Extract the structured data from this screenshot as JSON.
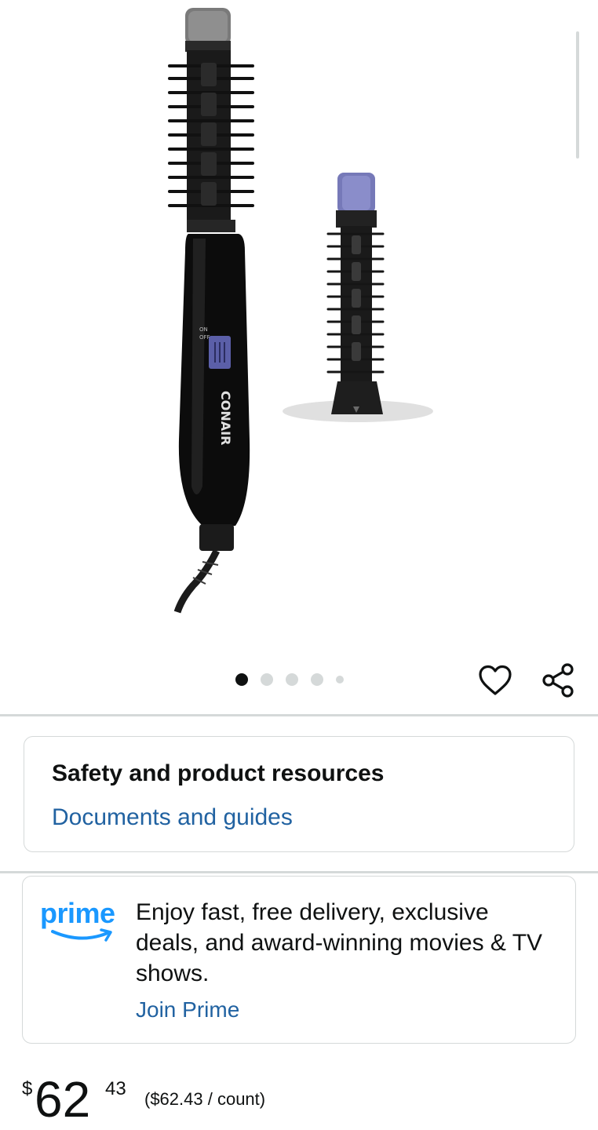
{
  "gallery": {
    "image_alt": "Conair hot air brush with interchangeable brush attachment",
    "brand_text": "CONAIR",
    "switch_on": "ON",
    "switch_off": "OFF",
    "dots_count": 5,
    "active_dot": 1
  },
  "actions": {
    "wishlist_icon": "heart-icon",
    "share_icon": "share-icon"
  },
  "safety": {
    "title": "Safety and product resources",
    "link": "Documents and guides"
  },
  "prime": {
    "logo_text": "prime",
    "text": "Enjoy fast, free delivery, exclusive deals, and award-winning movies & TV shows.",
    "link": "Join Prime"
  },
  "price": {
    "symbol": "$",
    "whole": "62",
    "fraction": "43",
    "unit_price": "($62.43 / count)"
  },
  "colors": {
    "link": "#2162a1",
    "prime_blue": "#1a98ff",
    "divider": "#d5d9d9",
    "text": "#0f1111"
  }
}
